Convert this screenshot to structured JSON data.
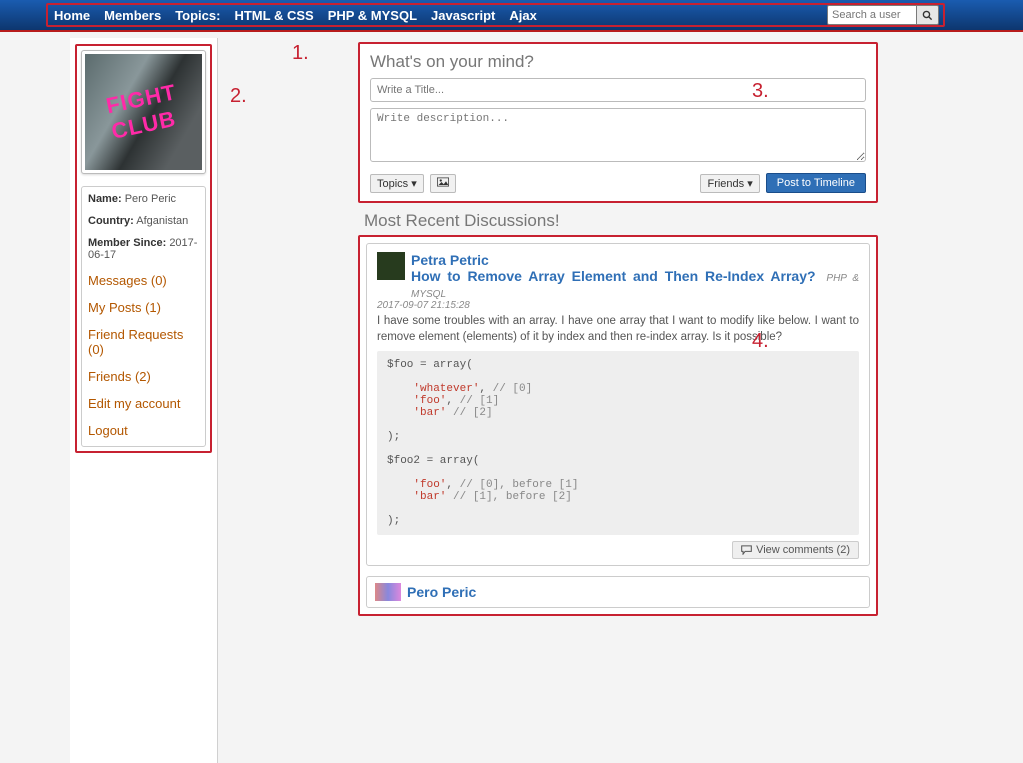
{
  "nav": {
    "home": "Home",
    "members": "Members",
    "topics_label": "Topics:",
    "html_css": "HTML & CSS",
    "php_mysql": "PHP & MYSQL",
    "javascript": "Javascript",
    "ajax": "Ajax"
  },
  "search": {
    "placeholder": "Search a user"
  },
  "annotations": {
    "a1": "1.",
    "a2": "2.",
    "a3": "3.",
    "a4": "4."
  },
  "profile": {
    "name_label": "Name:",
    "name_value": "Pero Peric",
    "country_label": "Country:",
    "country_value": "Afganistan",
    "since_label": "Member Since:",
    "since_value": "2017-06-17",
    "links": {
      "messages": "Messages (0)",
      "my_posts": "My Posts (1)",
      "friend_requests": "Friend Requests (0)",
      "friends": "Friends (2)",
      "edit": "Edit my account",
      "logout": "Logout"
    }
  },
  "composer": {
    "heading": "What's on your mind?",
    "title_placeholder": "Write a Title...",
    "desc_placeholder": "Write description...",
    "topics_btn": "Topics ▾",
    "friends_btn": "Friends ▾",
    "post_btn": "Post to Timeline"
  },
  "section_title": "Most Recent Discussions!",
  "discussion1": {
    "author": "Petra Petric",
    "title": "How to Remove Array Element and Then Re-Index Array?",
    "category": "PHP & MYSQL",
    "timestamp": "2017-09-07 21:15:28",
    "body": "I have some troubles with an array. I have one array that I want to modify like below. I want to remove element (elements) of it by index and then re-index array. Is it possible?",
    "comments_btn": "View comments (2)"
  },
  "discussion2": {
    "author": "Pero Peric"
  }
}
